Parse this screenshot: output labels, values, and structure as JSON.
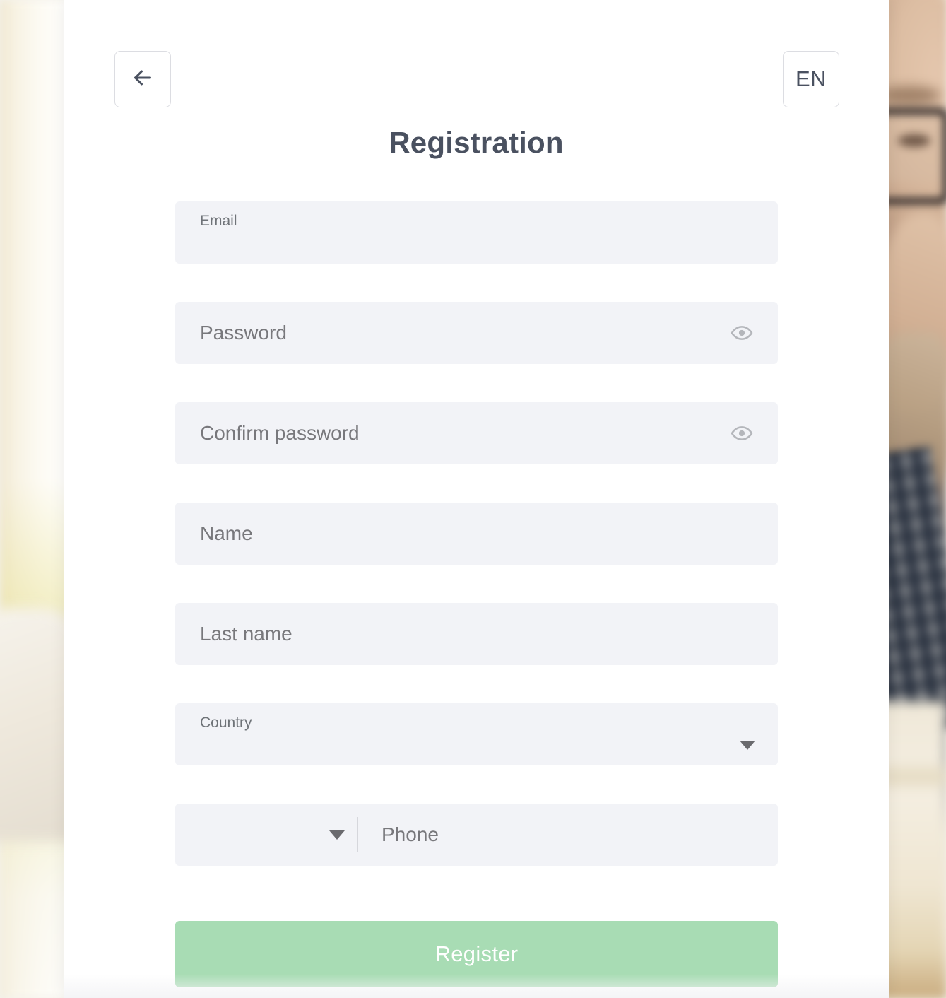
{
  "header": {
    "back_icon": "arrow-left-icon",
    "language_label": "EN",
    "title": "Registration"
  },
  "form": {
    "fields": [
      {
        "name": "email",
        "label": "Email",
        "label_style": "floating",
        "value": ""
      },
      {
        "name": "password",
        "label": "Password",
        "label_style": "placeholder",
        "value": "",
        "trailing_icon": "eye-icon"
      },
      {
        "name": "confirm_password",
        "label": "Confirm password",
        "label_style": "placeholder",
        "value": "",
        "trailing_icon": "eye-icon"
      },
      {
        "name": "first_name",
        "label": "Name",
        "label_style": "placeholder",
        "value": ""
      },
      {
        "name": "last_name",
        "label": "Last name",
        "label_style": "placeholder",
        "value": ""
      },
      {
        "name": "country",
        "label": "Country",
        "label_style": "floating",
        "value": "",
        "trailing_icon": "chevron-down-icon"
      }
    ],
    "phone": {
      "country_code_value": "",
      "country_code_icon": "chevron-down-icon",
      "label": "Phone",
      "value": ""
    },
    "submit_label": "Register"
  },
  "colors": {
    "accent_green": "#a8dcb4",
    "field_background": "#f2f3f7",
    "text_dark": "#4a5160",
    "text_muted": "#78787c",
    "card_background": "#ffffff"
  }
}
